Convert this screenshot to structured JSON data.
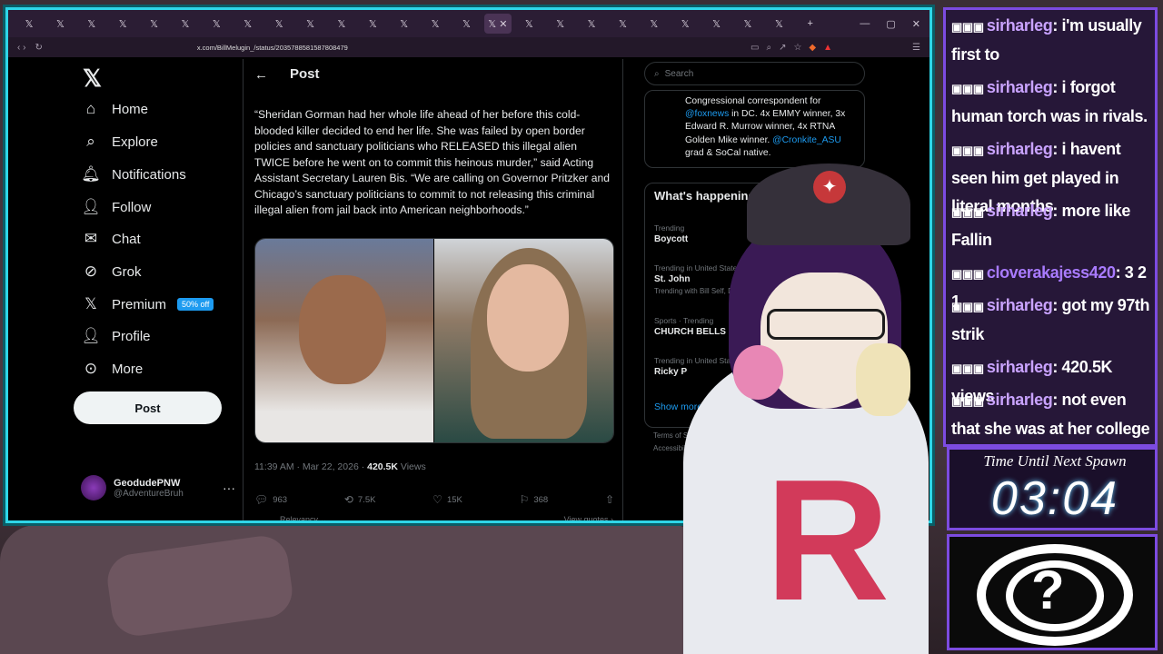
{
  "browser": {
    "url": "x.com/BillMelugin_/status/2035788581587808479"
  },
  "x_nav": {
    "items": [
      {
        "label": "Home",
        "icon": "home-icon"
      },
      {
        "label": "Explore",
        "icon": "search-icon"
      },
      {
        "label": "Notifications",
        "icon": "bell-icon"
      },
      {
        "label": "Follow",
        "icon": "person-add-icon"
      },
      {
        "label": "Chat",
        "icon": "mail-icon"
      },
      {
        "label": "Grok",
        "icon": "grok-icon"
      },
      {
        "label": "Premium",
        "icon": "x-icon",
        "badge": "50% off"
      },
      {
        "label": "Profile",
        "icon": "person-icon"
      },
      {
        "label": "More",
        "icon": "more-circle-icon"
      }
    ],
    "post_button": "Post",
    "account": {
      "name": "GeodudePNW",
      "handle": "@AdventureBruh"
    }
  },
  "post": {
    "header": "Post",
    "text": "“Sheridan Gorman had her whole life ahead of her before this cold-blooded killer decided to end her life. She was failed by open border policies and sanctuary politicians who RELEASED this illegal alien TWICE before he went on to commit this heinous murder,” said Acting Assistant Secretary Lauren Bis. “We are calling on Governor Pritzker and Chicago’s sanctuary politicians to commit to not releasing this criminal illegal alien from jail back into American neighborhoods.”",
    "time": "11:39 AM · Mar 22, 2026 · ",
    "views_count": "420.5K",
    "views_label": " Views",
    "replies": "963",
    "reposts": "7.5K",
    "likes": "15K",
    "bookmarks": "368",
    "relevancy": "Relevancy ⌄",
    "view_quotes": "View quotes ›"
  },
  "sidebar": {
    "search_placeholder": "Search",
    "bio": {
      "line1": "Congressional correspondent for",
      "link1": "@foxnews",
      "line2": " in DC. 4x EMMY winner, 3x Edward R. Murrow winner, 4x RTNA Golden Mike winner. ",
      "link2": "@Cronkite_ASU",
      "line3": " grad & SoCal native."
    },
    "trends_title": "What's happening",
    "trends": [
      {
        "meta": "Trending",
        "name": "Boycott",
        "with": ""
      },
      {
        "meta": "Trending in United States",
        "name": "St. John",
        "with": "Trending with Bill Self, Dy..."
      },
      {
        "meta": "Sports · Trending",
        "name": "CHURCH BELLS",
        "with": ""
      },
      {
        "meta": "Trending in United States",
        "name": "Ricky P",
        "with": ""
      }
    ],
    "show_more": "Show more",
    "footer1": "Terms of Ser...",
    "footer2": "Accessibility"
  },
  "chat": {
    "messages": [
      {
        "user": "sirharleg",
        "text": ": i'm usually first to"
      },
      {
        "user": "sirharleg",
        "text": ": i forgot human torch was in rivals."
      },
      {
        "user": "sirharleg",
        "text": ": i havent seen him get played in literal months"
      },
      {
        "user": "sirharleg",
        "text": ": more like Fallin"
      },
      {
        "user": "cloverakajess420",
        "text": ": 3 2 1"
      },
      {
        "user": "sirharleg",
        "text": ": got my 97th strik"
      },
      {
        "user": "sirharleg",
        "text": ": 420.5K views"
      },
      {
        "user": "sirharleg",
        "text": ": not even that she was at her college"
      }
    ]
  },
  "timer": {
    "label": "Time Until Next Spawn",
    "value": "03:04"
  },
  "colors": {
    "accent": "#1d9bf0",
    "frame": "#2fd6e8",
    "chat_border": "#7c4be0"
  }
}
